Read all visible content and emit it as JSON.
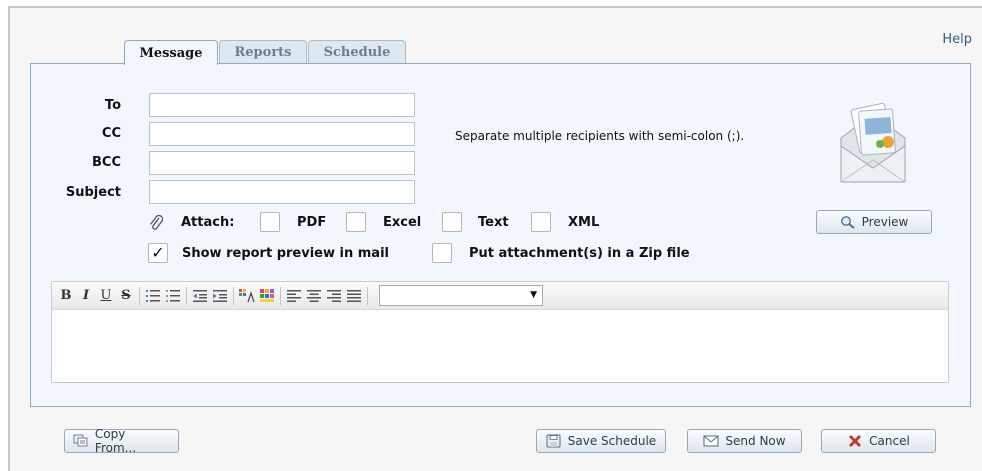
{
  "help_label": "Help",
  "tabs": [
    {
      "label": "Message",
      "active": true
    },
    {
      "label": "Reports",
      "active": false
    },
    {
      "label": "Schedule",
      "active": false
    }
  ],
  "fields": {
    "to": {
      "label": "To",
      "value": ""
    },
    "cc": {
      "label": "CC",
      "value": ""
    },
    "bcc": {
      "label": "BCC",
      "value": ""
    },
    "subject": {
      "label": "Subject",
      "value": ""
    }
  },
  "hint": "Separate multiple recipients with semi-colon (;).",
  "attach": {
    "label": "Attach:",
    "options": [
      {
        "label": "PDF",
        "checked": false
      },
      {
        "label": "Excel",
        "checked": false
      },
      {
        "label": "Text",
        "checked": false
      },
      {
        "label": "XML",
        "checked": false
      }
    ]
  },
  "show_preview": {
    "label": "Show report preview in mail",
    "checked": true
  },
  "zip": {
    "label": "Put attachment(s) in a Zip file",
    "checked": false
  },
  "preview_button": "Preview",
  "editor": {
    "toolbar": [
      "B",
      "I",
      "U",
      "S"
    ],
    "font_value": ""
  },
  "footer": {
    "copy_from": "Copy From...",
    "save_schedule": "Save Schedule",
    "send_now": "Send Now",
    "cancel": "Cancel"
  },
  "colors": {
    "panel_bg": "#f1f7fc",
    "panel_border": "#8eabc6",
    "tab_text": "#6a7d94",
    "link": "#3a5b86"
  }
}
